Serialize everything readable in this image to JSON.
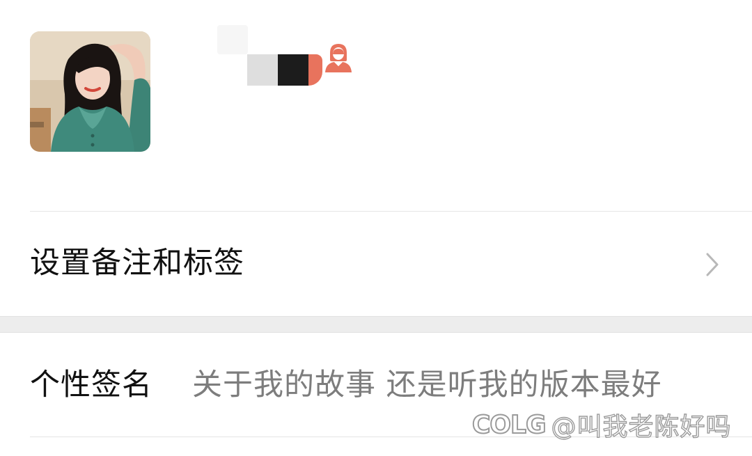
{
  "profile": {
    "avatar_icon": "profile-photo",
    "gender_icon": "female-user-icon",
    "gender_color": "#e8735d"
  },
  "remark_row": {
    "label": "设置备注和标签",
    "chevron_icon": "chevron-right-icon"
  },
  "signature_row": {
    "label": "个性签名",
    "value": "关于我的故事 还是听我的版本最好"
  },
  "watermark": {
    "logo": "COLG",
    "text": "@叫我老陈好吗"
  }
}
